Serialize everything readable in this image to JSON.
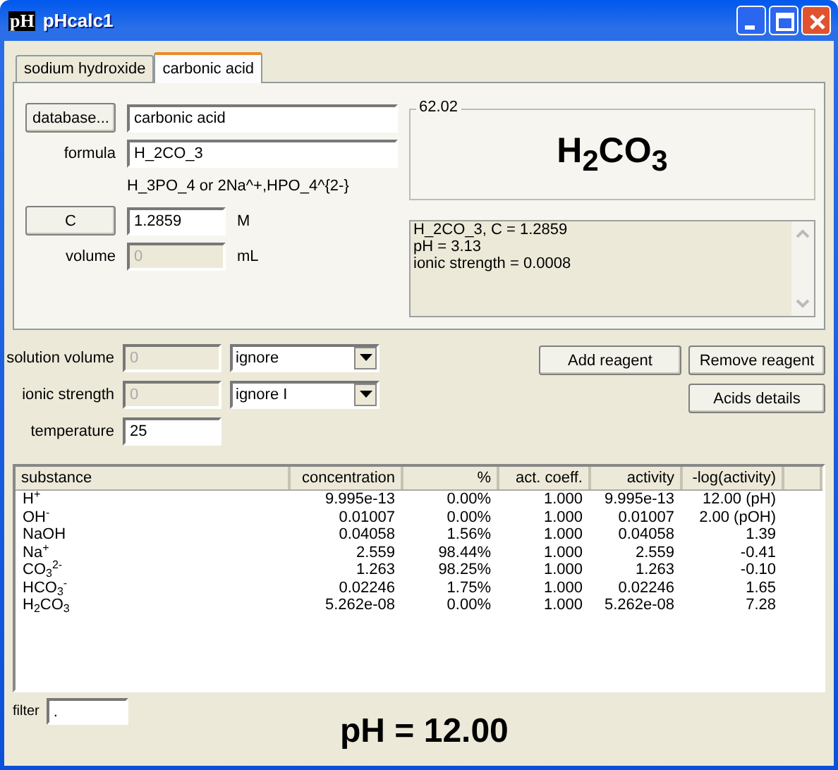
{
  "window": {
    "icon_text": "pH",
    "title": "pHcalc1"
  },
  "tabs": [
    {
      "label": "sodium hydroxide",
      "selected": false
    },
    {
      "label": "carbonic acid",
      "selected": true
    }
  ],
  "reagent": {
    "database_button": "database...",
    "name": "carbonic acid",
    "formula_label": "formula",
    "formula": "H_2CO_3",
    "hint": "H_3PO_4 or 2Na^+,HPO_4^{2-}",
    "c_button": "C",
    "c_value": "1.2859",
    "c_unit": "M",
    "volume_label": "volume",
    "volume": "0",
    "volume_unit": "mL",
    "molar_mass": "62.02",
    "formula_display": "H$_{2}$CO$_{3}$",
    "log": [
      "H_2CO_3, C = 1.2859",
      "pH = 3.13",
      "ionic strength = 0.0008"
    ]
  },
  "settings": [
    {
      "label": "solution volume",
      "value": "0",
      "disabled": true,
      "option": "ignore"
    },
    {
      "label": "ionic strength",
      "value": "0",
      "disabled": true,
      "option": "ignore I"
    },
    {
      "label": "temperature",
      "value": "25",
      "disabled": false
    }
  ],
  "buttons": {
    "add": "Add reagent",
    "remove": "Remove reagent",
    "details": "Acids details"
  },
  "table": {
    "columns": [
      "substance",
      "concentration",
      "%",
      "act. coeff.",
      "activity",
      "-log(activity)"
    ],
    "rows": [
      [
        "H$^{+}$",
        "9.995e-13",
        "0.00%",
        "1.000",
        "9.995e-13",
        "12.00 (pH)"
      ],
      [
        "OH$^{-}$",
        "0.01007",
        "0.00%",
        "1.000",
        "0.01007",
        "2.00 (pOH)"
      ],
      [
        "NaOH",
        "0.04058",
        "1.56%",
        "1.000",
        "0.04058",
        "1.39"
      ],
      [
        "Na$^{+}$",
        "2.559",
        "98.44%",
        "1.000",
        "2.559",
        "-0.41"
      ],
      [
        "CO$_{3}$$^{2-}$",
        "1.263",
        "98.25%",
        "1.000",
        "1.263",
        "-0.10"
      ],
      [
        "HCO$_{3}$$^{-}$",
        "0.02246",
        "1.75%",
        "1.000",
        "0.02246",
        "1.65"
      ],
      [
        "H$_{2}$CO$_{3}$",
        "5.262e-08",
        "0.00%",
        "1.000",
        "5.262e-08",
        "7.28"
      ]
    ]
  },
  "filter": {
    "label": "filter",
    "value": "."
  },
  "result": "pH = 12.00"
}
